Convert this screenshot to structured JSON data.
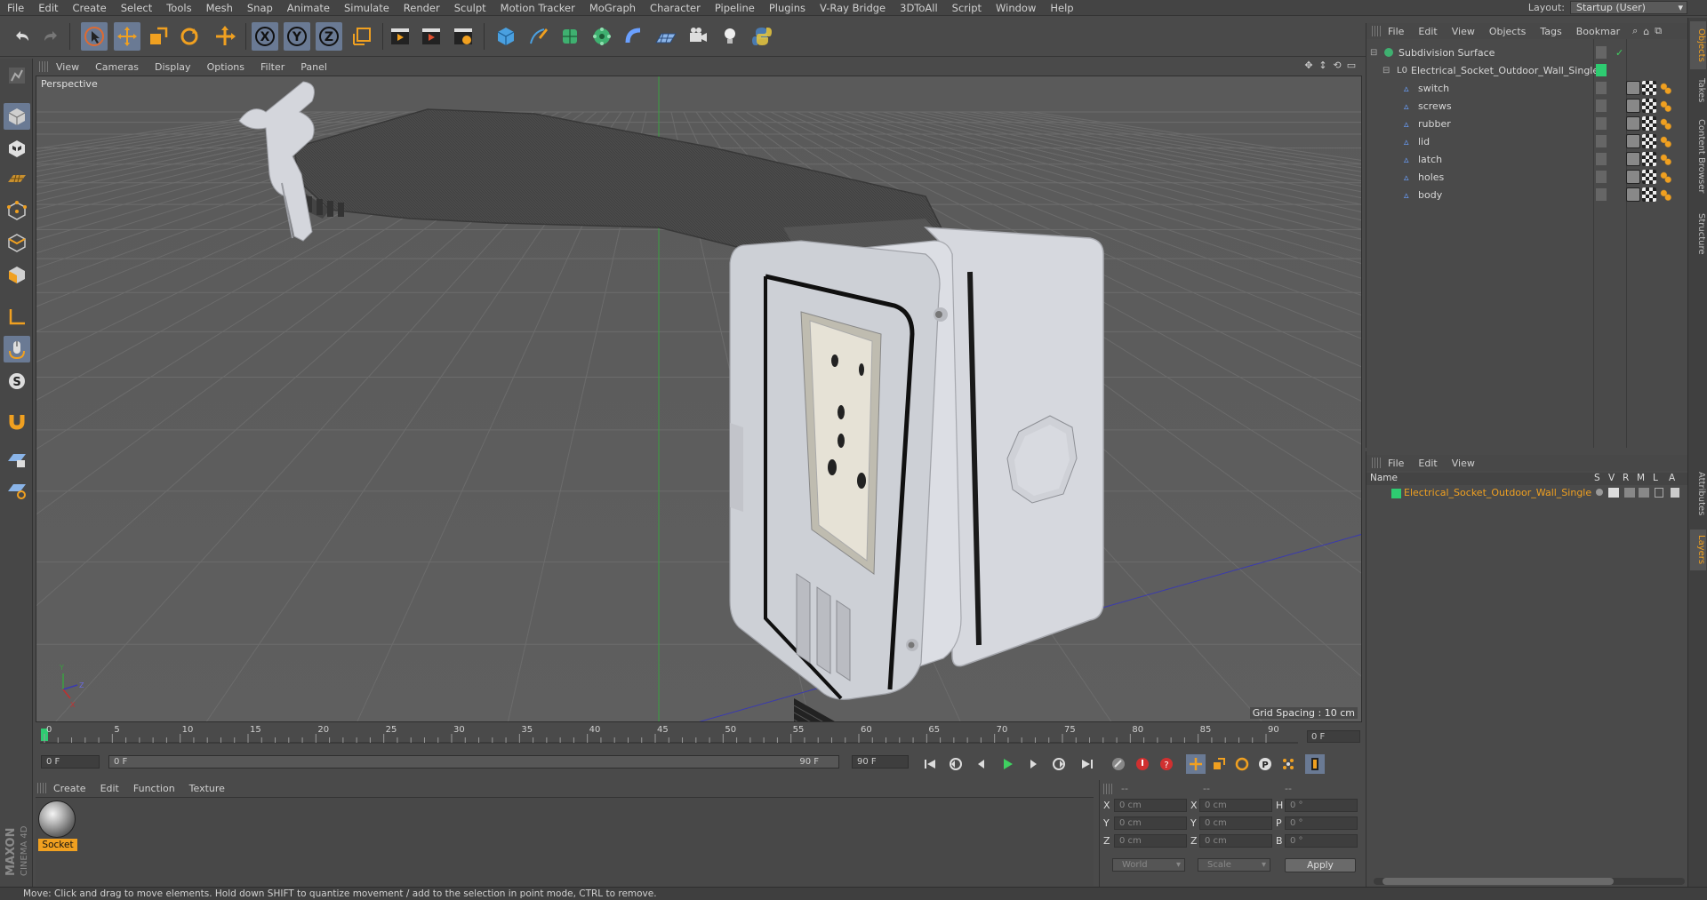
{
  "menubar": {
    "items": [
      "File",
      "Edit",
      "Create",
      "Select",
      "Tools",
      "Mesh",
      "Snap",
      "Animate",
      "Simulate",
      "Render",
      "Sculpt",
      "Motion Tracker",
      "MoGraph",
      "Character",
      "Pipeline",
      "Plugins",
      "V-Ray Bridge",
      "3DToAll",
      "Script",
      "Window",
      "Help"
    ],
    "layout_label": "Layout:",
    "layout_value": "Startup (User)"
  },
  "viewport": {
    "menu": [
      "View",
      "Cameras",
      "Display",
      "Options",
      "Filter",
      "Panel"
    ],
    "label": "Perspective",
    "grid_spacing": "Grid Spacing : 10 cm"
  },
  "timeline": {
    "ticks": [
      "0",
      "5",
      "10",
      "15",
      "20",
      "25",
      "30",
      "35",
      "40",
      "45",
      "50",
      "55",
      "60",
      "65",
      "70",
      "75",
      "80",
      "85",
      "90"
    ],
    "current_frame": "0 F"
  },
  "transport": {
    "start_field": "0 F",
    "slider_start": "0 F",
    "slider_end": "90 F",
    "end_field": "90 F"
  },
  "material_manager": {
    "menu": [
      "Create",
      "Edit",
      "Function",
      "Texture"
    ],
    "materials": [
      {
        "name": "Socket"
      }
    ]
  },
  "coordinates": {
    "header": [
      "--",
      "--",
      "--"
    ],
    "rows": [
      {
        "a_label": "X",
        "a_val": "0 cm",
        "b_label": "X",
        "b_val": "0 cm",
        "c_label": "H",
        "c_val": "0 °"
      },
      {
        "a_label": "Y",
        "a_val": "0 cm",
        "b_label": "Y",
        "b_val": "0 cm",
        "c_label": "P",
        "c_val": "0 °"
      },
      {
        "a_label": "Z",
        "a_val": "0 cm",
        "b_label": "Z",
        "b_val": "0 cm",
        "c_label": "B",
        "c_val": "0 °"
      }
    ],
    "space_dropdown": "World",
    "mode_dropdown": "Scale",
    "apply_label": "Apply"
  },
  "object_manager": {
    "menu": [
      "File",
      "Edit",
      "View",
      "Objects",
      "Tags",
      "Bookmar"
    ],
    "objects": [
      {
        "name": "Subdivision Surface"
      },
      {
        "name": "Electrical_Socket_Outdoor_Wall_Single"
      },
      {
        "name": "switch"
      },
      {
        "name": "screws"
      },
      {
        "name": "rubber"
      },
      {
        "name": "lid"
      },
      {
        "name": "latch"
      },
      {
        "name": "holes"
      },
      {
        "name": "body"
      }
    ]
  },
  "layer_manager": {
    "menu": [
      "File",
      "Edit",
      "View"
    ],
    "columns": [
      "Name",
      "S",
      "V",
      "R",
      "M",
      "L",
      "A"
    ],
    "layers": [
      {
        "name": "Electrical_Socket_Outdoor_Wall_Single",
        "color": "#2ecc71"
      }
    ]
  },
  "side_tabs": [
    "Objects",
    "Takes",
    "Content Browser",
    "Structure",
    "Attributes",
    "Layers"
  ],
  "status": {
    "text": "Move: Click and drag to move elements. Hold down SHIFT to quantize movement / add to the selection in point mode, CTRL to remove."
  },
  "logo": {
    "text": "MAXON CINEMA 4D"
  },
  "colors": {
    "accent": "#f0a020",
    "active_tool": "#6a7a94",
    "layer_green": "#2ecc71"
  }
}
